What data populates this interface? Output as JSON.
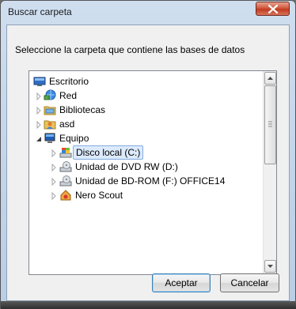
{
  "window": {
    "title": "Buscar carpeta",
    "prompt": "Seleccione la carpeta que contiene las bases de datos"
  },
  "tree": {
    "items": [
      {
        "label": "Escritorio",
        "icon": "desktop-icon",
        "expander": "none"
      },
      {
        "label": "Red",
        "icon": "network-icon",
        "expander": "collapsed"
      },
      {
        "label": "Bibliotecas",
        "icon": "libraries-icon",
        "expander": "collapsed"
      },
      {
        "label": "asd",
        "icon": "user-folder-icon",
        "expander": "collapsed"
      },
      {
        "label": "Equipo",
        "icon": "computer-icon",
        "expander": "expanded"
      },
      {
        "label": "Disco local (C:)",
        "icon": "local-disk-icon",
        "expander": "collapsed",
        "selected": true
      },
      {
        "label": "Unidad de DVD RW (D:)",
        "icon": "dvd-drive-icon",
        "expander": "collapsed"
      },
      {
        "label": "Unidad de BD-ROM (F:) OFFICE14",
        "icon": "bd-drive-icon",
        "expander": "collapsed"
      },
      {
        "label": "Nero Scout",
        "icon": "nero-scout-icon",
        "expander": "collapsed"
      }
    ]
  },
  "buttons": {
    "ok": "Aceptar",
    "cancel": "Cancelar"
  },
  "colors": {
    "selection_bg": "#dceafc",
    "selection_border": "#84acdd",
    "close_button": "#c0391f"
  }
}
